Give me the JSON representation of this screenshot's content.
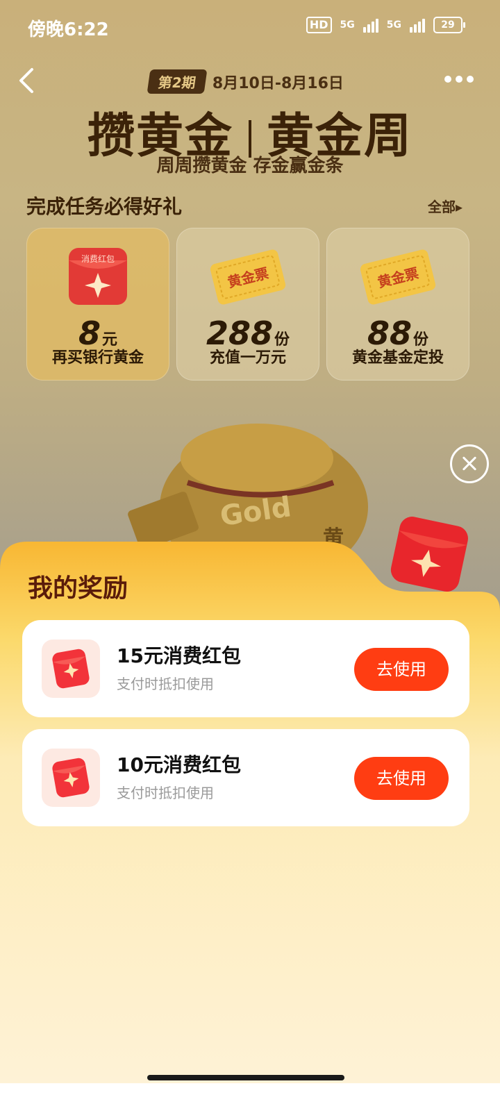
{
  "status_bar": {
    "time": "傍晚6:22",
    "hd": "HD",
    "network1": "5G",
    "network2": "5G",
    "battery": "29"
  },
  "header": {
    "period_badge": "第2期",
    "period_dates": "8月10日-8月16日",
    "title_left": "攒黄金",
    "title_right": "黄金周",
    "subtitle": "周周攒黄金 存金赢金条"
  },
  "tasks": {
    "heading": "完成任务必得好礼",
    "all_label": "全部",
    "cards": [
      {
        "image_text": "消费红包",
        "value": "8",
        "unit": "元",
        "label": "再买银行黄金"
      },
      {
        "image_text": "黄金票",
        "value": "288",
        "unit": "份",
        "label": "充值一万元"
      },
      {
        "image_text": "黄金票",
        "value": "88",
        "unit": "份",
        "label": "黄金基金定投"
      }
    ]
  },
  "background_art": {
    "gold_text": "Gold",
    "gold_char": "黄"
  },
  "rewards": {
    "title": "我的奖励",
    "items": [
      {
        "title": "15元消费红包",
        "desc": "支付时抵扣使用",
        "button": "去使用"
      },
      {
        "title": "10元消费红包",
        "desc": "支付时抵扣使用",
        "button": "去使用"
      }
    ]
  },
  "colors": {
    "accent": "#ff3d12",
    "title_brown": "#3b2208",
    "sheet_title": "#5a1c0a"
  }
}
